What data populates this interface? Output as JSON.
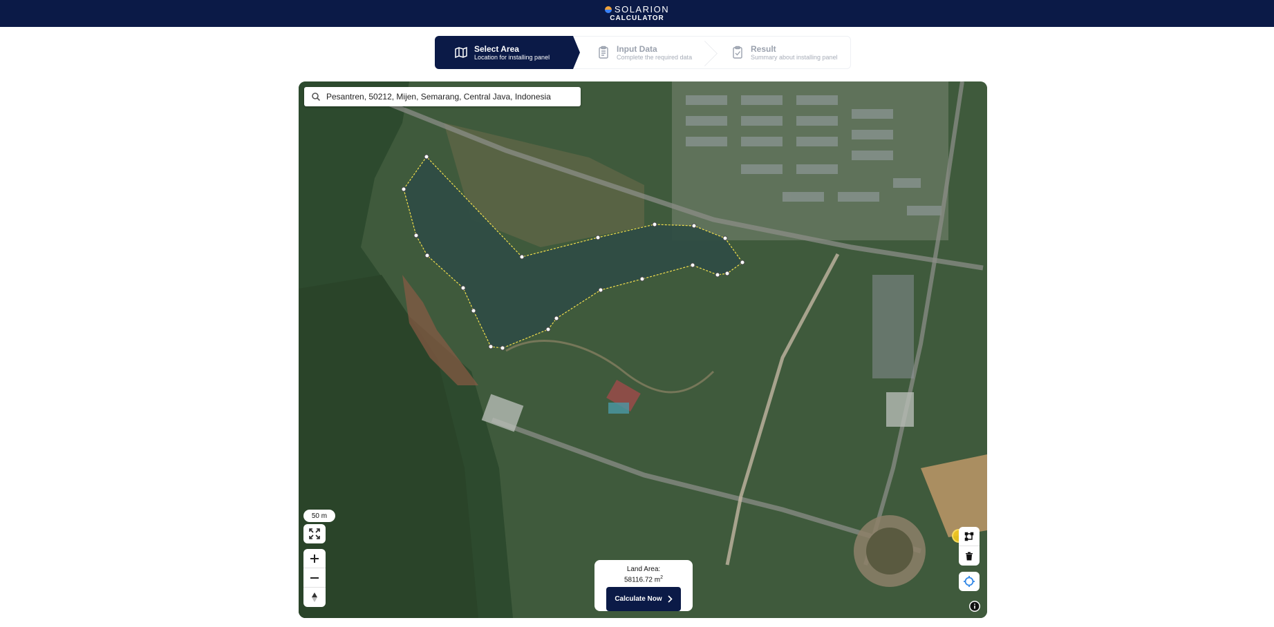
{
  "header": {
    "brand_name": "SOLARION",
    "brand_sub": "CALCULATOR",
    "brand_colors": {
      "navy": "#0b1a47",
      "sun": "#f2a33a",
      "accent": "#3b82f6"
    }
  },
  "stepper": {
    "steps": [
      {
        "title": "Select Area",
        "subtitle": "Location for installing panel",
        "icon": "map-icon",
        "state": "active"
      },
      {
        "title": "Input Data",
        "subtitle": "Complete the required data",
        "icon": "clipboard-list-icon",
        "state": "inactive"
      },
      {
        "title": "Result",
        "subtitle": "Summary about installing panel",
        "icon": "clipboard-check-icon",
        "state": "inactive"
      }
    ]
  },
  "map": {
    "search": {
      "value": "Pesantren, 50212, Mijen, Semarang, Central Java, Indonesia",
      "icon": "search-icon"
    },
    "scale_label": "50 m",
    "controls": [
      "fullscreen-icon",
      "zoom-in-icon",
      "zoom-out-icon",
      "compass-icon",
      "draw-polygon-icon",
      "trash-icon",
      "locate-icon",
      "info-icon"
    ],
    "polygon_color": "#f4e04d"
  },
  "area_card": {
    "label": "Land Area:",
    "value": "58116.72 m",
    "unit_sup": "2",
    "button_label": "Calculate Now"
  }
}
